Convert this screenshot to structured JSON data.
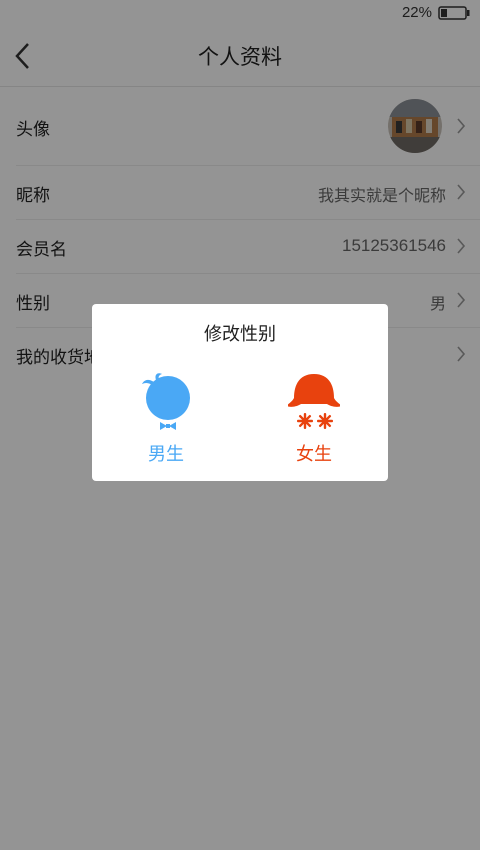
{
  "status_bar": {
    "battery_percent": "22%"
  },
  "header": {
    "title": "个人资料"
  },
  "profile_rows": {
    "avatar": {
      "label": "头像"
    },
    "nickname": {
      "label": "昵称",
      "value": "我其实就是个昵称"
    },
    "member_name": {
      "label": "会员名",
      "value": "15125361546"
    },
    "gender": {
      "label": "性别",
      "value": "男"
    },
    "address": {
      "label": "我的收货地址"
    }
  },
  "dialog": {
    "title": "修改性别",
    "male": {
      "label": "男生",
      "color": "#4aa8f5"
    },
    "female": {
      "label": "女生",
      "color": "#e8420e"
    }
  }
}
